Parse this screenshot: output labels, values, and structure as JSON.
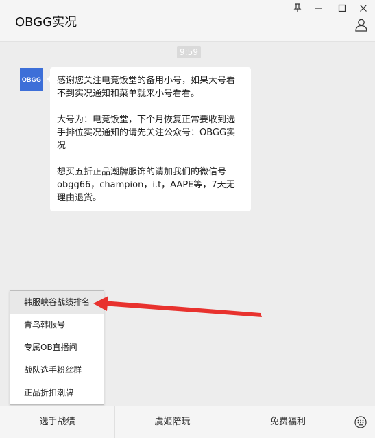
{
  "window": {
    "title": "OBGG实况",
    "pin_icon": "pin-icon",
    "minimize_icon": "minimize-icon",
    "maximize_icon": "maximize-icon",
    "close_icon": "close-icon",
    "profile_icon": "person-icon"
  },
  "chat": {
    "time": "9:59",
    "avatar_text": "OBGG",
    "message": {
      "para1": "感谢您关注电竞饭堂的备用小号，如果大号看不到实况通知和菜单就来小号看看。",
      "para2": "大号为：电竞饭堂，下个月恢复正常要收到选手排位实况通知的请先关注公众号：OBGG实况",
      "para3": "想买五折正品潮牌服饰的请加我们的微信号obgg66，champion，i.t，AAPE等，7天无理由退货。"
    }
  },
  "submenu": {
    "items": [
      {
        "label": "韩服峡谷战绩排名"
      },
      {
        "label": "青鸟韩服号"
      },
      {
        "label": "专属OB直播间"
      },
      {
        "label": "战队选手粉丝群"
      },
      {
        "label": "正品折扣潮牌"
      }
    ]
  },
  "bottom_menu": {
    "items": [
      {
        "label": "选手战绩"
      },
      {
        "label": "虞姬陪玩"
      },
      {
        "label": "免费福利"
      }
    ],
    "keyboard_icon": "keyboard-icon"
  },
  "annotation": {
    "arrow_color": "#e8322e"
  }
}
